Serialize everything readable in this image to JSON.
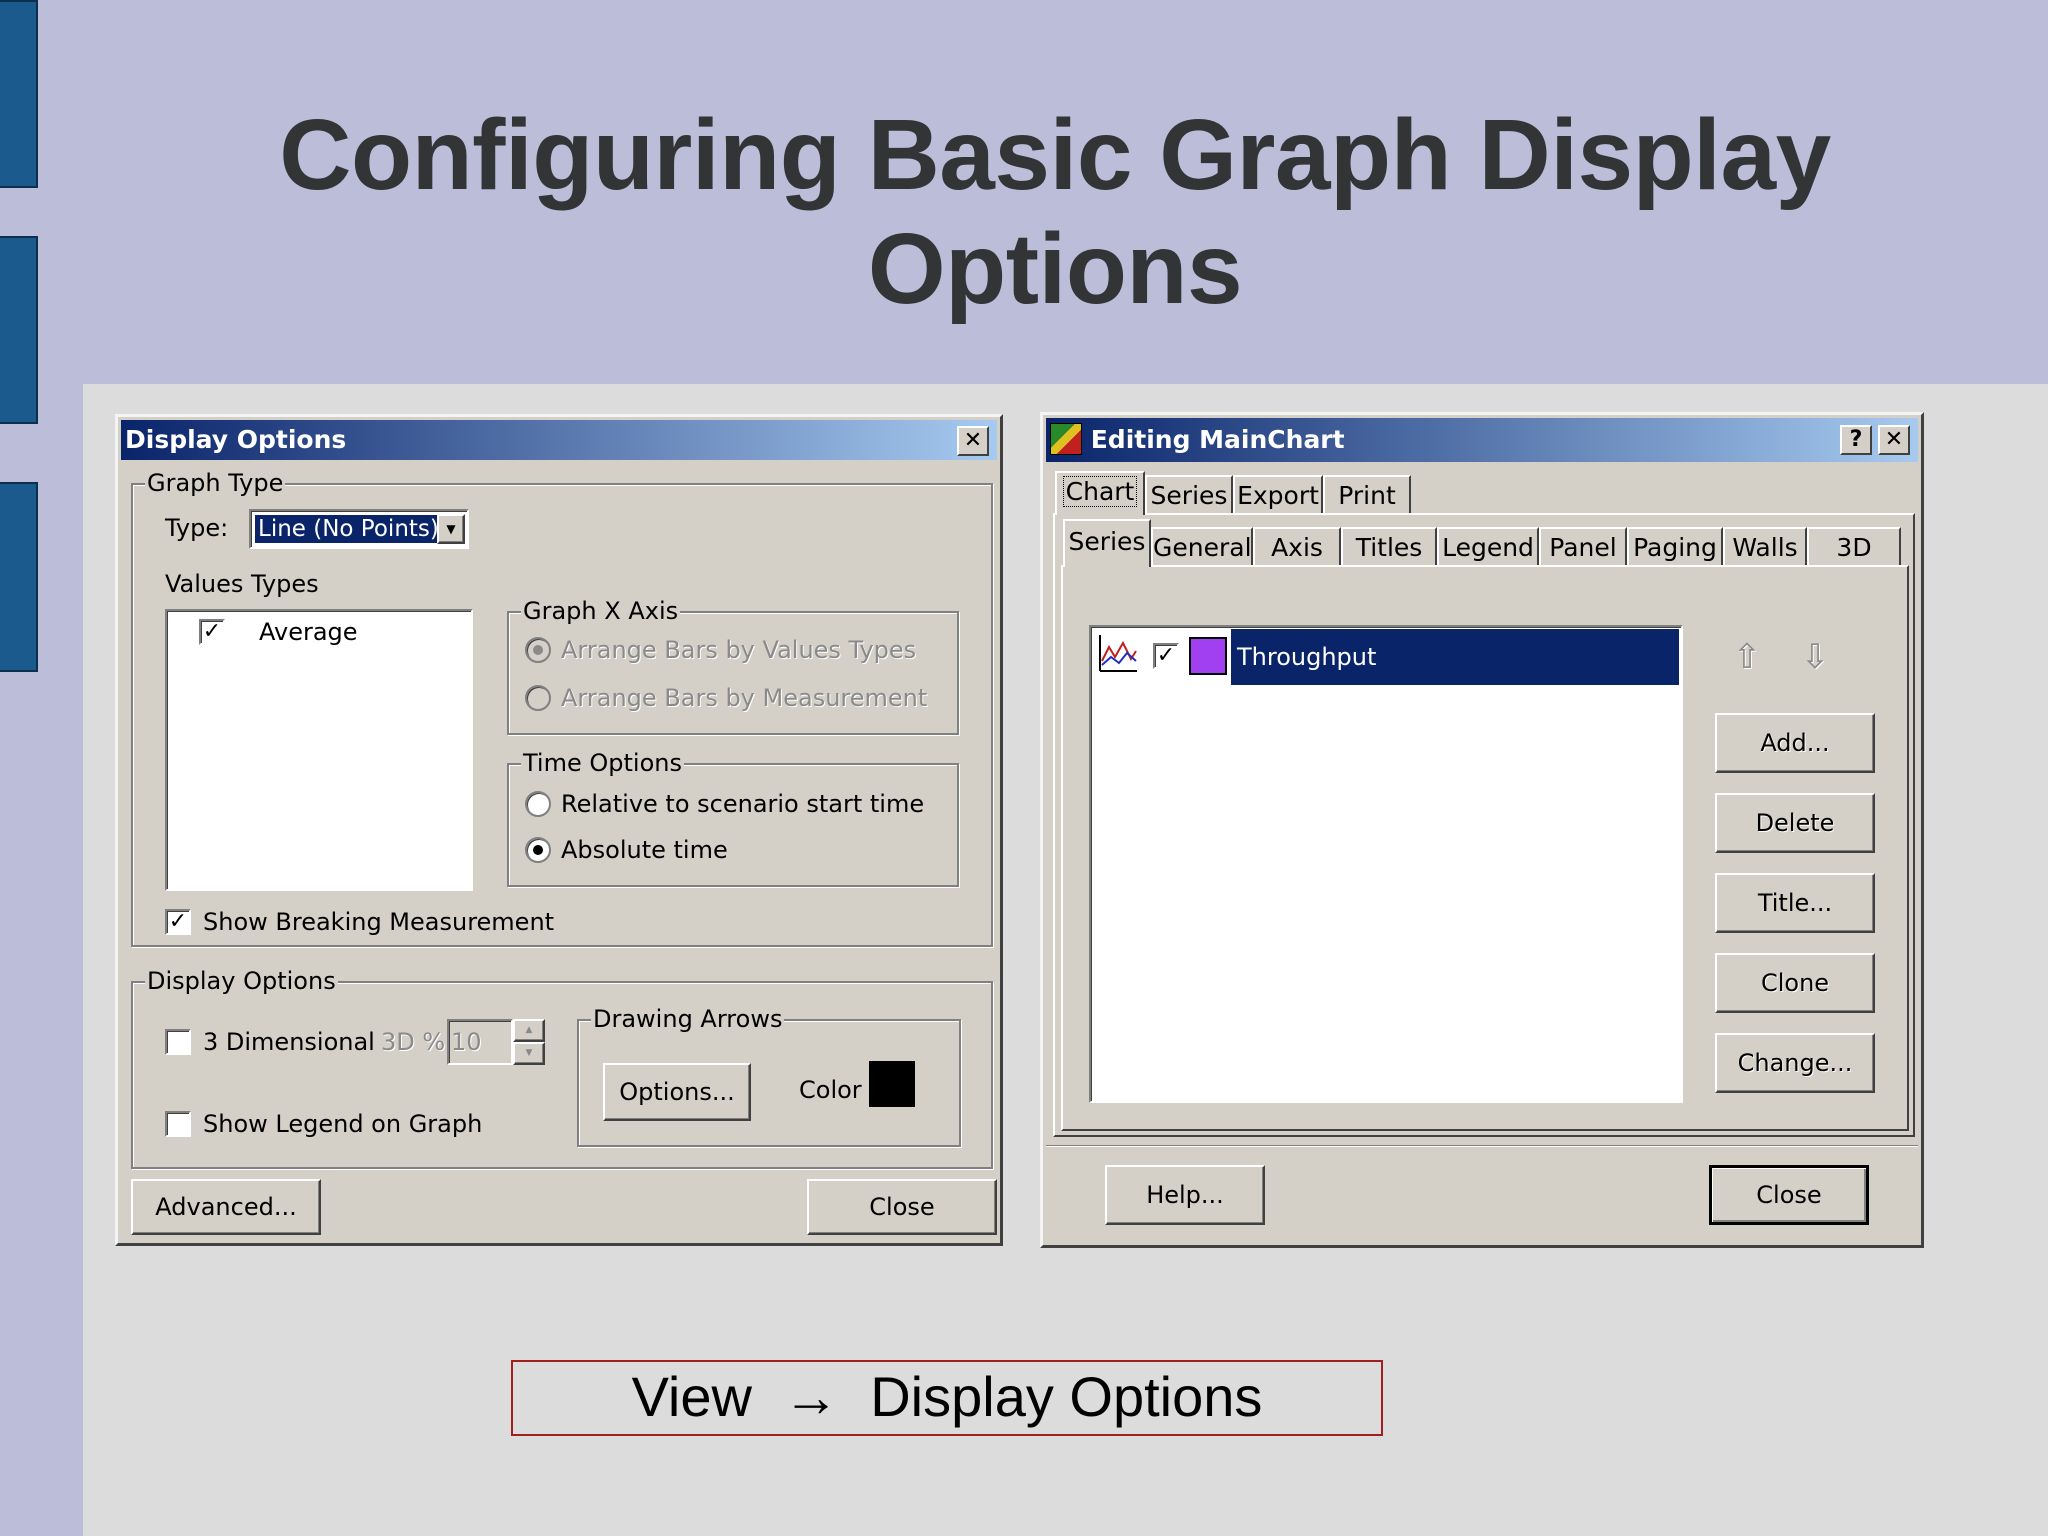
{
  "slide": {
    "title": "Configuring Basic Graph Display Options",
    "caption_left": "View",
    "caption_right": "Display Options"
  },
  "display_options_dialog": {
    "title": "Display Options",
    "graph_type_group": "Graph Type",
    "type_label": "Type:",
    "type_value": "Line (No Points)",
    "values_types_label": "Values Types",
    "values_types_items": [
      {
        "label": "Average",
        "checked": true
      }
    ],
    "graph_x_axis_group": "Graph X Axis",
    "arrange_by_values": "Arrange Bars by Values Types",
    "arrange_by_measurement": "Arrange Bars by Measurement",
    "time_options_group": "Time Options",
    "relative_time": "Relative to scenario start time",
    "absolute_time": "Absolute time",
    "show_breaking": "Show Breaking Measurement",
    "display_options_group": "Display Options",
    "three_d": "3 Dimensional",
    "three_d_percent_label": "3D %:",
    "three_d_percent_value": "10",
    "show_legend": "Show Legend on Graph",
    "drawing_arrows_group": "Drawing Arrows",
    "options_button": "Options...",
    "color_label": "Color",
    "color_value": "#000000",
    "advanced_button": "Advanced...",
    "close_button": "Close"
  },
  "editing_chart_dialog": {
    "title": "Editing MainChart",
    "help_icon": "?",
    "top_tabs": [
      "Chart",
      "Series",
      "Export",
      "Print"
    ],
    "sub_tabs": [
      "Series",
      "General",
      "Axis",
      "Titles",
      "Legend",
      "Panel",
      "Paging",
      "Walls",
      "3D"
    ],
    "series_items": [
      {
        "name": "Throughput",
        "checked": true,
        "color": "#a040f0"
      }
    ],
    "add_button": "Add...",
    "delete_button": "Delete",
    "title_button": "Title...",
    "clone_button": "Clone",
    "change_button": "Change...",
    "help_button": "Help...",
    "close_button": "Close"
  }
}
